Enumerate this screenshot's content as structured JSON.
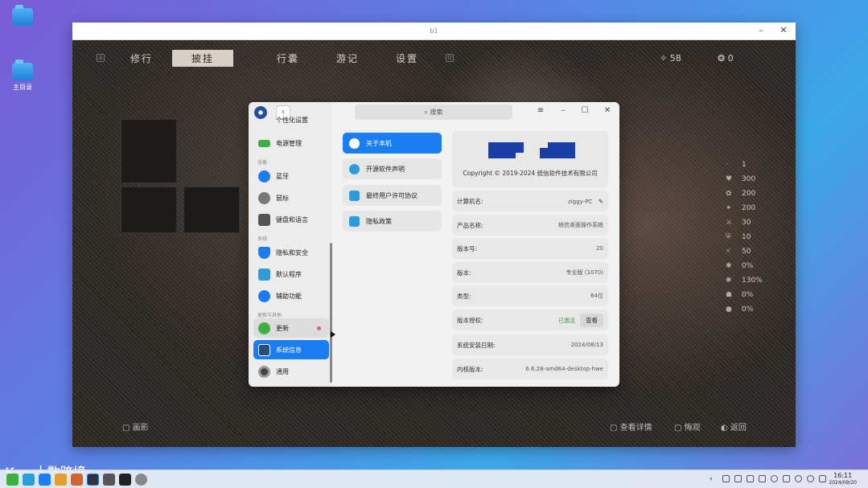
{
  "desktop": {
    "icons": [
      {
        "label": "",
        "name": "folder-icon"
      },
      {
        "label": "主目录",
        "name": "home-folder-icon"
      }
    ]
  },
  "game_window": {
    "title": "b1",
    "tabs": [
      "修行",
      "披挂",
      "行囊",
      "游记",
      "设置"
    ],
    "selected_tab": "披挂",
    "key_hints": {
      "left": "A",
      "right": "D"
    },
    "currency": [
      {
        "icon": "spark-icon",
        "value": "58"
      },
      {
        "icon": "spiral-icon",
        "value": "0"
      }
    ],
    "stats": [
      "1",
      "300",
      "200",
      "200",
      "30",
      "10",
      "50",
      "0%",
      "130%",
      "0%",
      "0%"
    ],
    "footer": {
      "left": "画影",
      "view_detail": "查看详情",
      "quick_view": "悔观",
      "back": "返回"
    }
  },
  "settings": {
    "search_placeholder": "搜索",
    "sidebar": {
      "partial_item": "个性化设置",
      "items": [
        {
          "label": "电源管理",
          "icon": "battery-icon",
          "color": "#3cb043"
        },
        {
          "label": "蓝牙",
          "icon": "bluetooth-icon",
          "color": "#1a7ef2"
        },
        {
          "label": "鼠标",
          "icon": "mouse-icon",
          "color": "#777777"
        },
        {
          "label": "键盘和语言",
          "icon": "keyboard-icon",
          "color": "#555555"
        },
        {
          "label": "隐私和安全",
          "icon": "shield-icon",
          "color": "#1a7ef2"
        },
        {
          "label": "默认程序",
          "icon": "default-app-icon",
          "color": "#2d9cdb"
        },
        {
          "label": "辅助功能",
          "icon": "accessibility-icon",
          "color": "#1a7ef2"
        },
        {
          "label": "更新",
          "icon": "update-icon",
          "color": "#3cb043"
        },
        {
          "label": "系统信息",
          "icon": "system-info-icon",
          "color": "#2b4b7a"
        },
        {
          "label": "通用",
          "icon": "general-icon",
          "color": "#444444"
        }
      ],
      "groups": [
        "设备",
        "系统",
        "更新与其他"
      ]
    },
    "menu": [
      {
        "label": "关于本机",
        "icon": "info-icon"
      },
      {
        "label": "开源软件声明",
        "icon": "copyright-icon"
      },
      {
        "label": "最终用户许可协议",
        "icon": "license-icon"
      },
      {
        "label": "隐私政策",
        "icon": "privacy-icon"
      }
    ],
    "copyright": "Copyright © 2019-2024 统信软件技术有限公司",
    "info": [
      {
        "label": "计算机名:",
        "value": "ziggy-PC"
      },
      {
        "label": "产品名称:",
        "value": "统信桌面操作系统"
      },
      {
        "label": "版本号:",
        "value": "20"
      },
      {
        "label": "版本:",
        "value": "专业版 (1070)"
      },
      {
        "label": "类型:",
        "value": "64位"
      },
      {
        "label": "版本授权:",
        "value": "已激活",
        "action": "查看"
      },
      {
        "label": "系统安装日期:",
        "value": "2024/08/13"
      },
      {
        "label": "内核版本:",
        "value": "6.6.28-amd64-desktop-hwe"
      }
    ]
  },
  "taskbar": {
    "time": "16:11",
    "date": "2024/09/20",
    "watermark": "大数跨境"
  }
}
